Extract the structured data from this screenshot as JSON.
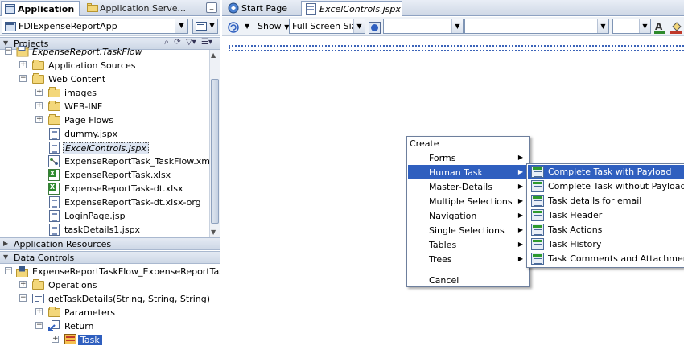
{
  "left_tabs": {
    "active": "Application",
    "inactive": "Application Serve...",
    "minimize": "_"
  },
  "app_selector": {
    "value": "FDIExpenseReportApp"
  },
  "projects": {
    "header": "Projects",
    "items": [
      {
        "label": "ExpenseReport.TaskFlow",
        "icon": "project-icon"
      },
      {
        "label": "Application Sources",
        "icon": "folder-icon"
      },
      {
        "label": "Web Content",
        "icon": "folder-icon"
      },
      {
        "label": "images",
        "icon": "folder-icon"
      },
      {
        "label": "WEB-INF",
        "icon": "folder-icon"
      },
      {
        "label": "Page Flows",
        "icon": "folder-icon"
      },
      {
        "label": "dummy.jspx",
        "icon": "page-icon"
      },
      {
        "label": "ExcelControls.jspx",
        "icon": "page-icon"
      },
      {
        "label": "ExpenseReportTask_TaskFlow.xml",
        "icon": "taskflow-icon"
      },
      {
        "label": "ExpenseReportTask.xlsx",
        "icon": "excel-icon"
      },
      {
        "label": "ExpenseReportTask-dt.xlsx",
        "icon": "excel-icon"
      },
      {
        "label": "ExpenseReportTask-dt.xlsx-org",
        "icon": "file-icon"
      },
      {
        "label": "LoginPage.jsp",
        "icon": "page-icon"
      },
      {
        "label": "taskDetails1.jspx",
        "icon": "page-icon"
      }
    ]
  },
  "application_resources": {
    "header": "Application Resources"
  },
  "data_controls": {
    "header": "Data Controls",
    "items": [
      {
        "label": "ExpenseReportTaskFlow_ExpenseReportTask"
      },
      {
        "label": "Operations"
      },
      {
        "label": "getTaskDetails(String, String, String)"
      },
      {
        "label": "Parameters"
      },
      {
        "label": "Return"
      },
      {
        "label": "Task"
      }
    ]
  },
  "editor_tabs": {
    "start": "Start Page",
    "active": "ExcelControls.jspx"
  },
  "toolbar": {
    "show_label": "Show",
    "size_value": "Full Screen Size"
  },
  "create_menu": {
    "header": "Create",
    "items": [
      "Forms",
      "Human Task",
      "Master-Details",
      "Multiple Selections",
      "Navigation",
      "Single Selections",
      "Tables",
      "Trees"
    ],
    "cancel": "Cancel"
  },
  "task_menu": {
    "items": [
      "Complete Task with Payload",
      "Complete Task without Payload",
      "Task details for email",
      "Task Header",
      "Task Actions",
      "Task History",
      "Task Comments and Attachments"
    ]
  },
  "colors": {
    "highlight": "#2f5fbf",
    "tab_bg": "#cfd8e6",
    "border": "#8ea2c2"
  }
}
